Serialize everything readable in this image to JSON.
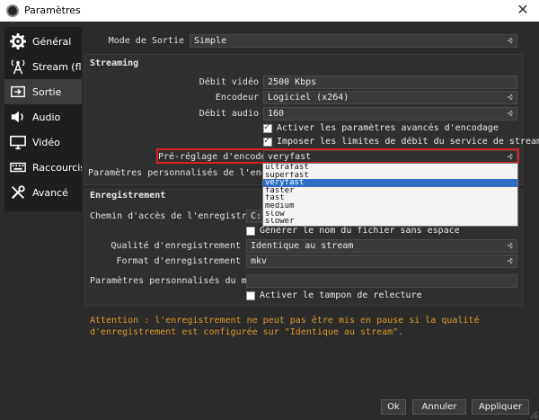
{
  "window": {
    "title": "Paramètres",
    "close_glyph": "✕"
  },
  "sidebar": {
    "items": [
      {
        "label": "Général",
        "icon": "gear-icon"
      },
      {
        "label": "Stream (flux)",
        "icon": "antenna-icon"
      },
      {
        "label": "Sortie",
        "icon": "output-icon",
        "active": true
      },
      {
        "label": "Audio",
        "icon": "speaker-icon"
      },
      {
        "label": "Vidéo",
        "icon": "monitor-icon"
      },
      {
        "label": "Raccourcis cl",
        "icon": "keyboard-icon"
      },
      {
        "label": "Avancé",
        "icon": "tools-icon"
      }
    ]
  },
  "output_mode": {
    "label": "Mode de Sortie",
    "value": "Simple"
  },
  "streaming": {
    "title": "Streaming",
    "video_bitrate": {
      "label": "Débit vidéo",
      "value": "2500 Kbps"
    },
    "encoder": {
      "label": "Encodeur",
      "value": "Logiciel (x264)"
    },
    "audio_bitrate": {
      "label": "Débit audio",
      "value": "160"
    },
    "advanced_check": {
      "label": "Activer les paramètres avancés d'encodage",
      "checked": true
    },
    "limits_check": {
      "label": "Imposer les limites de débit du service de streaming",
      "checked": true
    },
    "preset": {
      "label": "Pré-réglage d'encodeur",
      "value": "veryfast"
    },
    "custom_settings": {
      "label": "Paramètres personnalisés de l'encodeur"
    },
    "preset_options": [
      "ultrafast",
      "superfast",
      "veryfast",
      "faster",
      "fast",
      "medium",
      "slow",
      "slower"
    ],
    "preset_selected_index": 2
  },
  "recording": {
    "title": "Enregistrement",
    "path": {
      "label": "Chemin d'accès de l'enregistrement",
      "value": "C:\\"
    },
    "no_space_check": {
      "label": "Générer le nom du fichier sans espace",
      "checked": false
    },
    "quality": {
      "label": "Qualité d'enregistrement",
      "value": "Identique au stream"
    },
    "format": {
      "label": "Format d'enregistrement",
      "value": "mkv"
    },
    "muxer": {
      "label": "Paramètres personnalisés du muxer",
      "value": ""
    },
    "replay_check": {
      "label": "Activer le tampon de relecture",
      "checked": false
    }
  },
  "warning": "Attention : l'enregistrement ne peut pas être mis en pause si la qualité d'enregistrement est configurée sur \"Identique au stream\".",
  "buttons": {
    "ok": "Ok",
    "cancel": "Annuler",
    "apply": "Appliquer"
  },
  "colors": {
    "background": "#2b2b2b",
    "sidebar": "#1e1e1e",
    "warning": "#d99a2a",
    "selection": "#2f6ec6",
    "highlight": "#d92020"
  }
}
